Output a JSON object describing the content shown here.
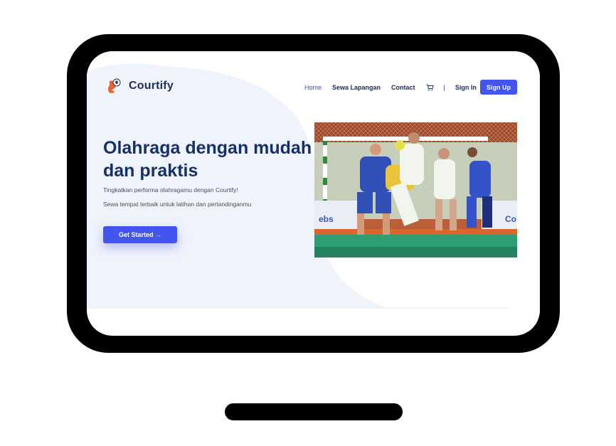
{
  "brand": {
    "name": "Courtify"
  },
  "nav": {
    "links": [
      {
        "label": "Home",
        "active": true
      },
      {
        "label": "Sewa Lapangan",
        "active": false
      },
      {
        "label": "Contact",
        "active": false
      }
    ],
    "cart_icon": "cart-icon",
    "divider": "|",
    "signin_label": "Sign In",
    "signup_label": "Sign Up"
  },
  "hero": {
    "title": "Olahraga dengan mudah dan praktis",
    "subtitle_line1": "Tingkatkan performa olahragamu dengan Courtify!",
    "subtitle_line2": "Sewa tempat terbaik untuk latihan dan pertandinganmu",
    "cta_label": "Get Started →",
    "image_icon": "handball-match-photo"
  },
  "colors": {
    "primary": "#4354f0",
    "navy": "#16306b",
    "hero_bg": "#eff3fb",
    "logo_orange": "#e8622c"
  }
}
